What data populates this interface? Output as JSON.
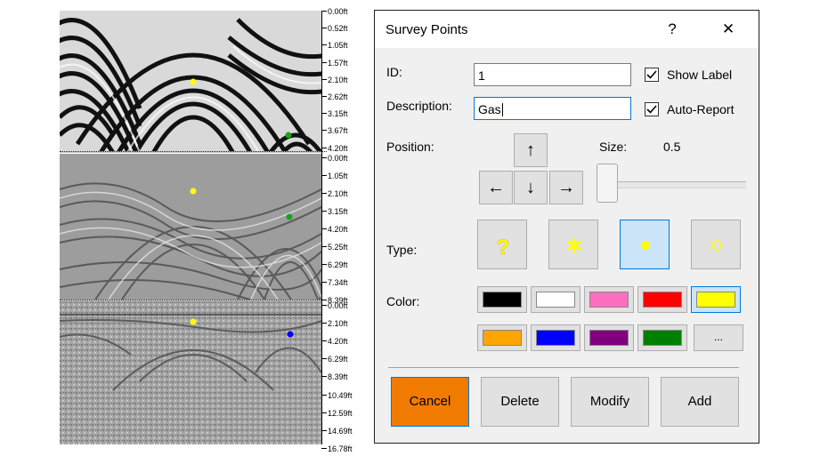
{
  "depth_scale": {
    "panel1": [
      "0.00ft",
      "0.52ft",
      "1.05ft",
      "1.57ft",
      "2.10ft",
      "2.62ft",
      "3.15ft",
      "3.67ft",
      "4.20ft"
    ],
    "panel2": [
      "0.00ft",
      "1.05ft",
      "2.10ft",
      "3.15ft",
      "4.20ft",
      "5.25ft",
      "6.29ft",
      "7.34ft",
      "8.39ft"
    ],
    "panel3": [
      "0.00ft",
      "2.10ft",
      "4.20ft",
      "6.29ft",
      "8.39ft",
      "10.49ft",
      "12.59ft",
      "14.69ft",
      "16.78ft"
    ]
  },
  "dialog": {
    "title": "Survey Points",
    "help_glyph": "?",
    "close_glyph": "✕",
    "id_label": "ID:",
    "id_value": "1",
    "description_label": "Description:",
    "description_value": "Gas",
    "show_label": {
      "label": "Show Label",
      "checked": true
    },
    "auto_report": {
      "label": "Auto-Report",
      "checked": true
    },
    "position_label": "Position:",
    "arrows": {
      "up": "↑",
      "left": "←",
      "down": "↓",
      "right": "→"
    },
    "size_label": "Size:",
    "size_value": "0.5",
    "type_label": "Type:",
    "types": [
      {
        "name": "question",
        "icon": "question-mark-icon",
        "selected": false
      },
      {
        "name": "star",
        "icon": "star-icon",
        "selected": false
      },
      {
        "name": "filled-dot",
        "icon": "filled-dot-icon",
        "selected": true
      },
      {
        "name": "hollow-dot",
        "icon": "hollow-dot-icon",
        "selected": false
      }
    ],
    "color_label": "Color:",
    "colors": [
      "#000000",
      "#ffffff",
      "#ff6fbf",
      "#ff0000",
      "#ffff00",
      "#ffa500",
      "#0000ff",
      "#800080",
      "#008000"
    ],
    "selected_color": "#ffff00",
    "more_colors_label": "...",
    "buttons": {
      "cancel": "Cancel",
      "delete": "Delete",
      "modify": "Modify",
      "add": "Add"
    }
  }
}
